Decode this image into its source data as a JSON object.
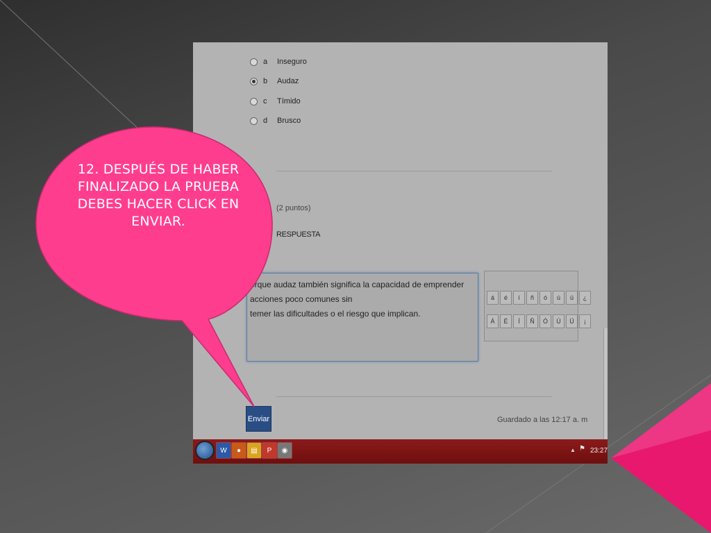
{
  "quiz": {
    "options": [
      {
        "letter": "a",
        "label": "Inseguro",
        "checked": false
      },
      {
        "letter": "b",
        "label": "Audaz",
        "checked": true
      },
      {
        "letter": "c",
        "label": "Tímido",
        "checked": false
      },
      {
        "letter": "d",
        "label": "Brusco",
        "checked": false
      }
    ],
    "points": "(2 puntos)",
    "response_label": "RESPUESTA",
    "answer_line1": "orque audaz también significa la capacidad de emprender acciones poco comunes sin",
    "answer_line2": "temer las dificultades o el riesgo que implican.",
    "charpad_row1": [
      "á",
      "é",
      "í",
      "ñ",
      "ó",
      "ú",
      "ü",
      "¿"
    ],
    "charpad_row2": [
      "Á",
      "É",
      "Í",
      "Ñ",
      "Ó",
      "Ú",
      "Ü",
      "¡"
    ],
    "submit_label": "Enviar",
    "saved_status": "Guardado a las 12:17 a. m"
  },
  "taskbar": {
    "clock": "23:27",
    "tray_arrow": "▲"
  },
  "callout": {
    "text": "12. DESPUÉS DE HABER FINALIZADO LA PRUEBA DEBES HACER CLICK EN ENVIAR.",
    "color": "#ff3d8e"
  },
  "colors": {
    "accent_pink": "#e8186f",
    "submit_blue": "#2a4d85"
  }
}
